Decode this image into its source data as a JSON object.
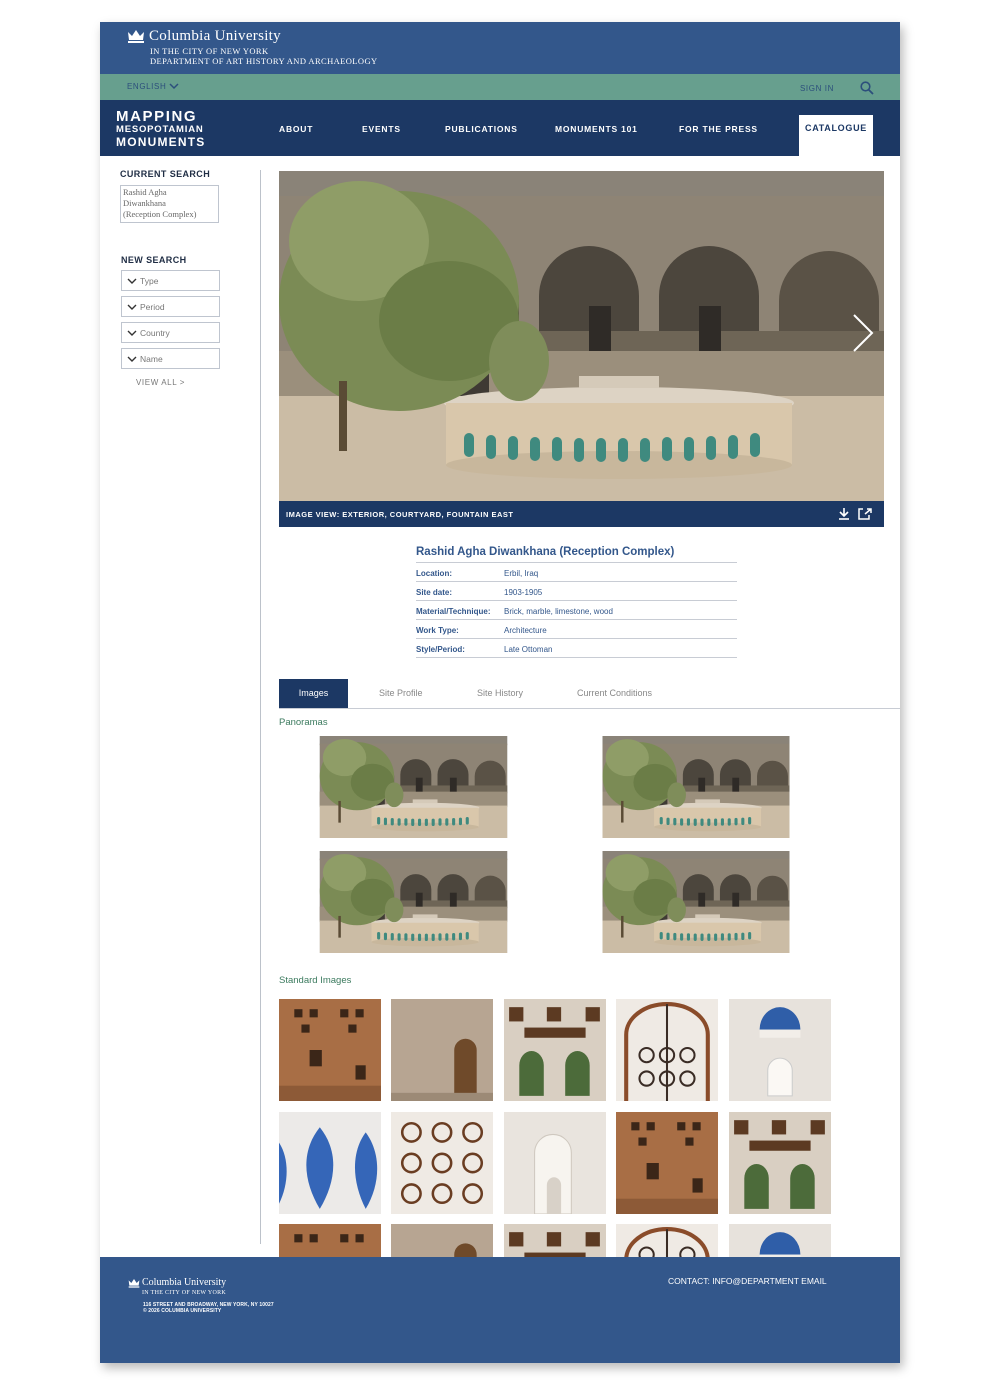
{
  "header": {
    "university": "Columbia University",
    "city": "IN THE CITY OF NEW YORK",
    "department": "DEPARTMENT OF ART HISTORY AND ARCHAEOLOGY"
  },
  "utility": {
    "language": "ENGLISH",
    "sign_in": "SIGN IN"
  },
  "brand": {
    "line1": "MAPPING",
    "line2": "MESOPOTAMIAN",
    "line3": "MONUMENTS"
  },
  "nav": {
    "items": [
      "ABOUT",
      "EVENTS",
      "PUBLICATIONS",
      "MONUMENTS 101",
      "FOR THE PRESS"
    ],
    "active": "CATALOGUE"
  },
  "sidebar": {
    "current_search_heading": "CURRENT SEARCH",
    "current_search_lines": [
      "Rashid Agha",
      "Diwankhana",
      "(Reception Complex)"
    ],
    "new_search_heading": "NEW SEARCH",
    "filters": [
      "Type",
      "Period",
      "Country",
      "Name"
    ],
    "view_all": "VIEW ALL >"
  },
  "hero": {
    "caption": "IMAGE VIEW: EXTERIOR, COURTYARD, FOUNTAIN EAST"
  },
  "monument": {
    "title": "Rashid Agha Diwankhana (Reception Complex)",
    "meta": [
      {
        "key": "Location:",
        "value": "Erbil, Iraq"
      },
      {
        "key": "Site date:",
        "value": "1903-1905"
      },
      {
        "key": "Material/Technique:",
        "value": "Brick, marble, limestone, wood"
      },
      {
        "key": "Work Type:",
        "value": "Architecture"
      },
      {
        "key": "Style/Period:",
        "value": "Late Ottoman"
      }
    ]
  },
  "tabs": {
    "active": "Images",
    "others": [
      "Site Profile",
      "Site History",
      "Current Conditions"
    ]
  },
  "sections": {
    "panoramas": "Panoramas",
    "standard": "Standard Images"
  },
  "footer": {
    "university": "Columbia University",
    "city": "IN THE CITY OF NEW YORK",
    "address": "116 STREET AND BROADWAY, NEW YORK, NY 10027",
    "copyright": "© 2026 COLUMBIA UNIVERSITY",
    "contact": "CONTACT: INFO@DEPARTMENT EMAIL"
  },
  "colors": {
    "header_blue": "#33578b",
    "nav_navy": "#1c3864",
    "util_green": "#679f8e",
    "section_green": "#3b7a5e"
  }
}
